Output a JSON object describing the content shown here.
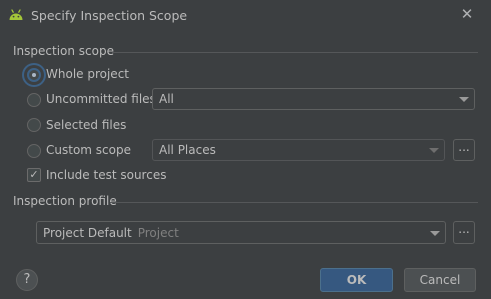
{
  "dialog": {
    "title": "Specify Inspection Scope",
    "close_glyph": "✕",
    "icon": "android-icon"
  },
  "inspection_scope": {
    "label": "Inspection scope",
    "options": [
      {
        "label": "Whole project",
        "checked": true
      },
      {
        "label": "Uncommitted files",
        "checked": false,
        "dropdown": "All"
      },
      {
        "label": "Selected files",
        "checked": false
      },
      {
        "label": "Custom scope",
        "checked": false,
        "dropdown": "All Places",
        "browse": "..."
      }
    ],
    "include_test_sources": {
      "label": "Include test sources",
      "checked": true,
      "glyph": "✓"
    }
  },
  "inspection_profile": {
    "label": "Inspection profile",
    "selected": "Project Default",
    "selected_hint": "Project",
    "browse": "..."
  },
  "footer": {
    "help": "?",
    "ok": "OK",
    "cancel": "Cancel"
  },
  "colors": {
    "background": "#3c3f41",
    "accent": "#365880",
    "android_green": "#a4c639"
  }
}
